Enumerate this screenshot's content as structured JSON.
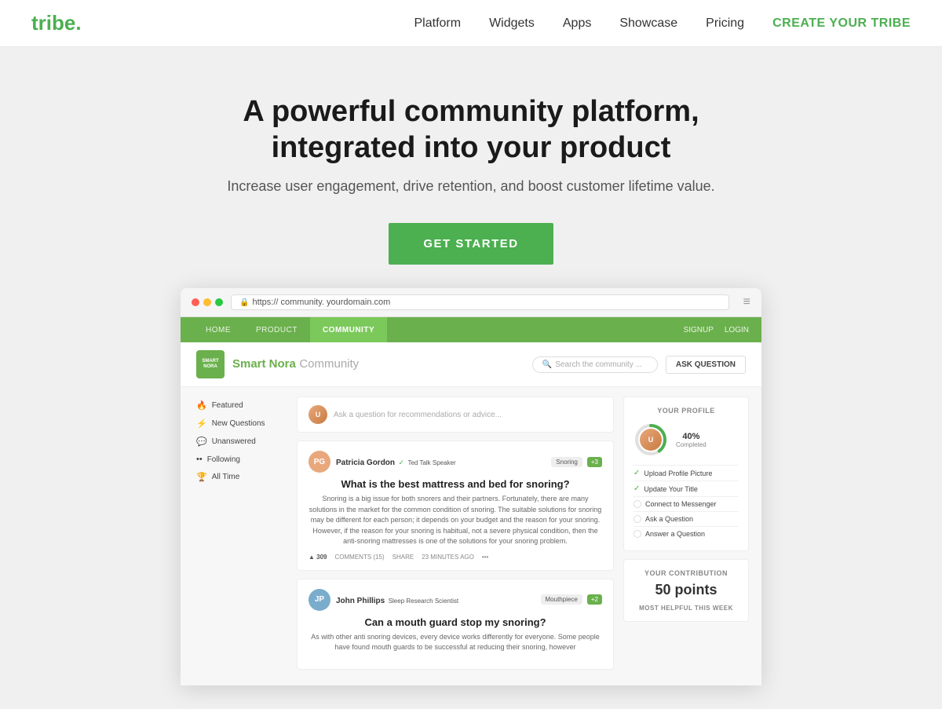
{
  "navbar": {
    "logo_text": "tribe",
    "logo_dot": ".",
    "nav_items": [
      {
        "label": "Platform",
        "id": "platform"
      },
      {
        "label": "Widgets",
        "id": "widgets"
      },
      {
        "label": "Apps",
        "id": "apps"
      },
      {
        "label": "Showcase",
        "id": "showcase"
      },
      {
        "label": "Pricing",
        "id": "pricing"
      }
    ],
    "cta_label": "CREATE YOUR TRIBE"
  },
  "hero": {
    "heading_line1": "A powerful community platform,",
    "heading_line2": "integrated into your product",
    "subtext": "Increase user engagement, drive retention, and boost customer lifetime value.",
    "cta_button": "GET STARTED"
  },
  "browser": {
    "url": "https:// community. yourdomain.com",
    "url_protocol": "https://",
    "url_domain": "community. yourdomain.com"
  },
  "app_nav": {
    "links": [
      {
        "label": "HOME",
        "active": false
      },
      {
        "label": "PRODUCT",
        "active": false
      },
      {
        "label": "COMMUNITY",
        "active": true
      }
    ],
    "right_links": [
      "SIGNUP",
      "LOGIN"
    ]
  },
  "community_header": {
    "logo_text": "SMART NORA",
    "brand_name": "Smart Nora",
    "community_label": "Community",
    "search_placeholder": "Search the community ...",
    "ask_button": "ASK QUESTION"
  },
  "sidebar": {
    "items": [
      {
        "icon": "🔥",
        "label": "Featured"
      },
      {
        "icon": "⚡",
        "label": "New Questions"
      },
      {
        "icon": "💬",
        "label": "Unanswered"
      },
      {
        "icon": "••",
        "label": "Following"
      },
      {
        "icon": "🏆",
        "label": "All Time"
      }
    ]
  },
  "ask_box": {
    "placeholder": "Ask a question for recommendations or advice..."
  },
  "posts": [
    {
      "author": "Patricia Gordon",
      "verify": "✓",
      "badge": "Ted Talk Speaker",
      "tag": "Snoring",
      "tag_extra": "+3",
      "title": "What is the best mattress and bed for snoring?",
      "text": "Snoring is a big issue for both snorers and their partners. Fortunately, there are many solutions in the market for the common condition of snoring. The suitable solutions for snoring may be different for each person; it depends on your budget and the reason for your snoring. However, if the reason for your snoring is habitual, not a severe physical condition, then the anti-snoring mattresses is one of the solutions for your snoring problem.",
      "votes": "309",
      "comments": "COMMENTS (15)",
      "share": "SHARE",
      "time": "23 MINUTES AGO",
      "avatar_bg": "#e8a87c",
      "avatar_initials": "PG"
    },
    {
      "author": "John Phillips",
      "verify": "",
      "badge": "Sleep Research Scientist",
      "tag": "Mouthpiece",
      "tag_extra": "+2",
      "title": "Can a mouth guard stop my snoring?",
      "text": "As with other anti snoring devices, every device works differently for everyone. Some people have found mouth guards to be successful at reducing their snoring, however",
      "votes": "",
      "comments": "",
      "share": "",
      "time": "",
      "avatar_bg": "#7aaccc",
      "avatar_initials": "JP"
    }
  ],
  "profile_card": {
    "title": "YOUR PROFILE",
    "percentage": "40%",
    "completed_label": "Completed",
    "actions": [
      {
        "label": "Upload Profile Picture",
        "done": true
      },
      {
        "label": "Update Your Title",
        "done": true
      },
      {
        "label": "Connect to Messenger",
        "done": false
      },
      {
        "label": "Ask a Question",
        "done": false
      },
      {
        "label": "Answer a Question",
        "done": false
      }
    ]
  },
  "contribution_card": {
    "title": "YOUR CONTRIBUTION",
    "points": "50 points",
    "helpful_label": "MOST HELPFUL THIS WEEK"
  }
}
